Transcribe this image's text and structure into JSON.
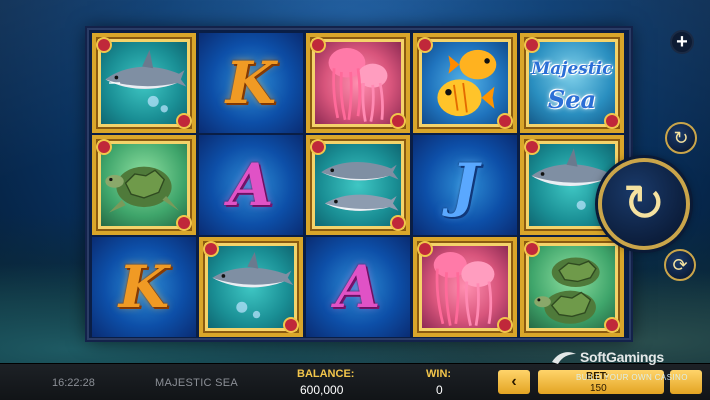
{
  "game": {
    "name": "MAJESTIC SEA",
    "logo_line1": "Majestic",
    "logo_line2": "Sea"
  },
  "reels": [
    [
      "shark",
      "K",
      "jellyfish",
      "fish",
      "logo"
    ],
    [
      "turtle",
      "A",
      "shark",
      "J",
      "shark"
    ],
    [
      "K",
      "shark",
      "A",
      "jellyfish",
      "turtle"
    ]
  ],
  "letters": {
    "k": "K",
    "a": "A",
    "j": "J"
  },
  "controls": {
    "plus_icon": "+",
    "autoplay_icon": "↻",
    "spin_icon": "↻",
    "turbo_icon": "⟳"
  },
  "status": {
    "time": "16:22:28",
    "balance_label": "BALANCE:",
    "balance_value": "600,000",
    "win_label": "WIN:",
    "win_value": "0",
    "bet_label": "BET:",
    "bet_value": "150",
    "bet_prev_icon": "‹"
  },
  "watermark": {
    "brand": "SoftGamings",
    "tagline": "BUILD YOUR OWN CASINO"
  },
  "colors": {
    "accent_gold": "#f3c64b",
    "frame_gold": "#d9a62a",
    "card_blue": "#0d4fa8"
  }
}
